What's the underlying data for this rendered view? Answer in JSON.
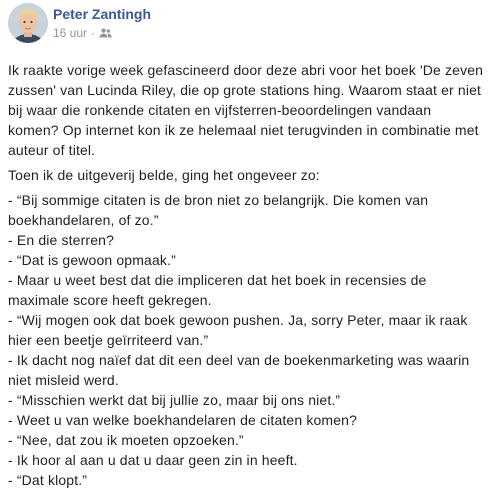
{
  "post": {
    "author": "Peter Zantingh",
    "timestamp": "16 uur",
    "separator": "·",
    "audience_icon": "friends-icon",
    "paragraph_1": "Ik raakte vorige week gefascineerd door deze abri voor het boek 'De zeven\nzussen' van Lucinda Riley, die op grote stations hing. Waarom staat er niet\nbij waar die ronkende citaten en vijfsterren-beoordelingen vandaan\nkomen? Op internet kon ik ze helemaal niet terugvinden in combinatie met\nauteur of titel.",
    "paragraph_2": "Toen ik de uitgeverij belde, ging het ongeveer zo:",
    "dialogue": [
      "- “Bij sommige citaten is de bron niet zo belangrijk. Die komen van",
      "boekhandelaren, of zo.”",
      "- En die sterren?",
      "- “Dat is gewoon opmaak.”",
      "- Maar u weet best dat die impliceren dat het boek in recensies de",
      "maximale score heeft gekregen.",
      "- “Wij mogen ook dat boek gewoon pushen. Ja, sorry Peter, maar ik raak",
      "hier een beetje geïrriteerd van.”",
      "- Ik dacht nog naïef dat dit een deel van de boekenmarketing was waarin",
      "niet misleid werd.",
      "- “Misschien werkt dat bij jullie zo, maar bij ons niet.”",
      "- Weet u van welke boekhandelaren de citaten komen?",
      "- “Nee, dat zou ik moeten opzoeken.”",
      "- Ik hoor al aan u dat u daar geen zin in heeft.",
      "- “Dat klopt.”"
    ]
  },
  "colors": {
    "author": "#385898",
    "meta": "#90949c",
    "text": "#1d2129"
  }
}
